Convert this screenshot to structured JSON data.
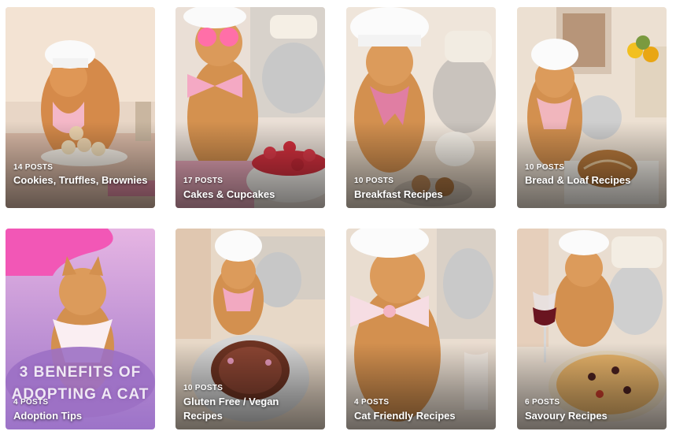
{
  "boards": [
    {
      "count": "14 POSTS",
      "title": "Cookies, Truffles, Brownies"
    },
    {
      "count": "17 POSTS",
      "title": "Cakes & Cupcakes"
    },
    {
      "count": "10 POSTS",
      "title": "Breakfast Recipes"
    },
    {
      "count": "10 POSTS",
      "title": "Bread & Loaf Recipes"
    },
    {
      "count": "4 POSTS",
      "title": "Adoption Tips",
      "overlay_line1": "3 BENEFITS OF",
      "overlay_line2": "ADOPTING A CAT"
    },
    {
      "count": "10 POSTS",
      "title": "Gluten Free / Vegan Recipes"
    },
    {
      "count": "4 POSTS",
      "title": "Cat Friendly Recipes"
    },
    {
      "count": "6 POSTS",
      "title": "Savoury Recipes"
    }
  ]
}
